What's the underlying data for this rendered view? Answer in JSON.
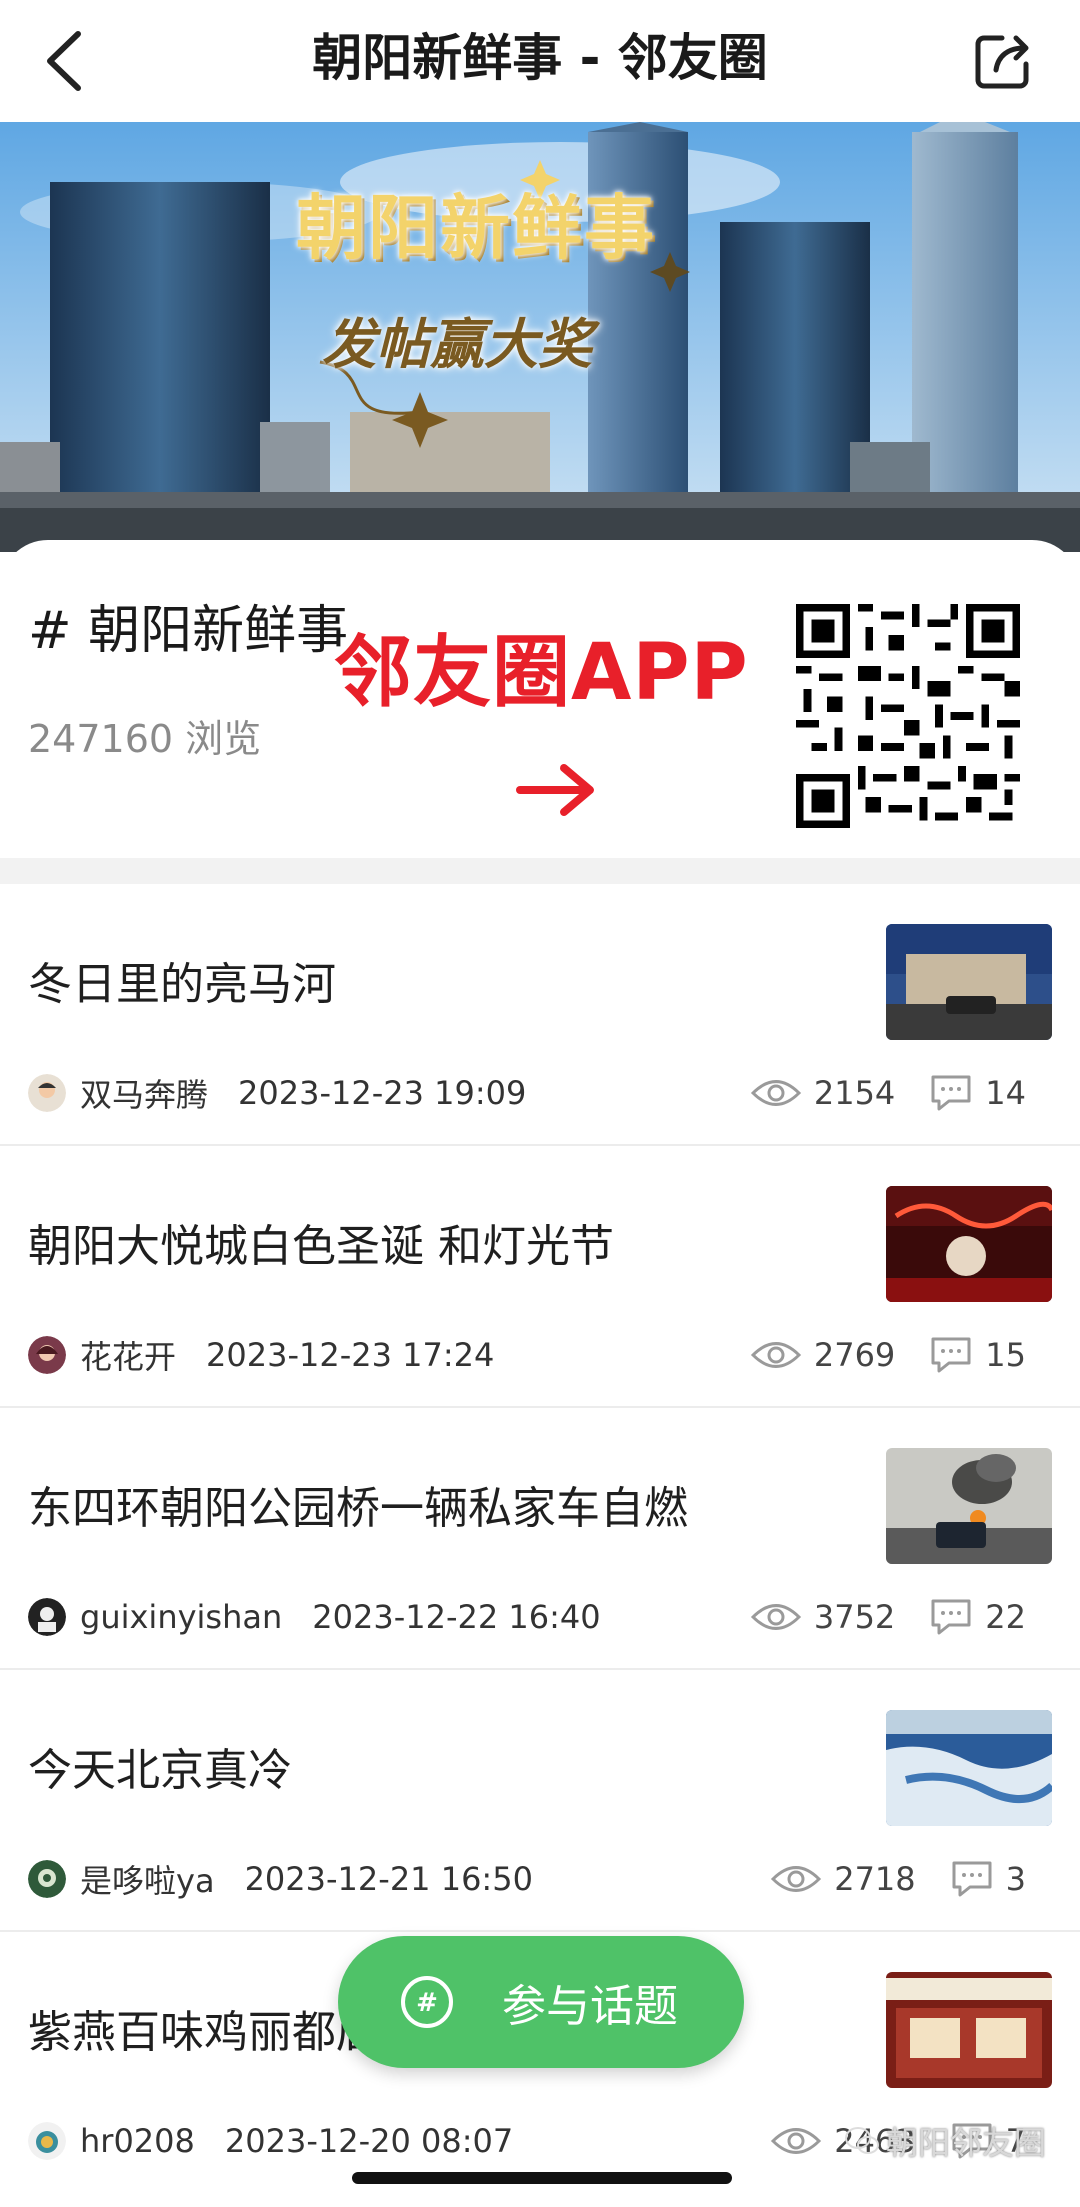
{
  "header": {
    "title": "朝阳新鲜事 - 邻友圈"
  },
  "banner": {
    "headline": "朝阳新鲜事",
    "subline": "发帖赢大奖"
  },
  "topic": {
    "name": "# 朝阳新鲜事",
    "views": "247160 浏览",
    "promo": "邻友圈APP"
  },
  "posts": [
    {
      "title": "冬日里的亮马河",
      "author": "双马奔腾",
      "time": "2023-12-23 19:09",
      "views": "2154",
      "comments": "14"
    },
    {
      "title": "朝阳大悦城白色圣诞 和灯光节",
      "author": "花花开",
      "time": "2023-12-23 17:24",
      "views": "2769",
      "comments": "15"
    },
    {
      "title": "东四环朝阳公园桥一辆私家车自燃",
      "author": "guixinyishan",
      "time": "2023-12-22 16:40",
      "views": "3752",
      "comments": "22"
    },
    {
      "title": "今天北京真冷",
      "author": "是哆啦ya",
      "time": "2023-12-21 16:50",
      "views": "2718",
      "comments": "3"
    },
    {
      "title": "紫燕百味鸡丽都店",
      "author": "hr0208",
      "time": "2023-12-20 08:07",
      "views": "2463",
      "comments": "7"
    }
  ],
  "fab": {
    "label": "参与话题"
  },
  "watermark": {
    "text": "朝阳邻友圈"
  },
  "colors": {
    "accent_green": "#4fc268",
    "promo_red": "#e8202a"
  }
}
